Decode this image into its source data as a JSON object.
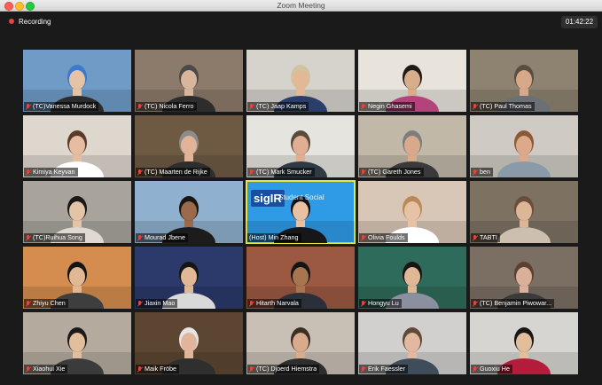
{
  "window": {
    "title": "Zoom Meeting",
    "controls": [
      "close-button",
      "minimize-button",
      "maximize-button"
    ]
  },
  "recording": {
    "label": "Recording",
    "color": "#e0473f"
  },
  "timer": {
    "value": "01:42:22"
  },
  "colors": {
    "active_speaker": "#e5e93a",
    "name_bar_bg": "rgba(0,0,0,0.55)",
    "muted_icon": "#e0473f"
  },
  "participants": [
    {
      "name": "(TC)Vanessa Murdock",
      "muted": true,
      "bg": "#6f9bc6",
      "skin": "#e6c3a5",
      "hair": "#3a7ad0",
      "shirt": "#2c2c2c"
    },
    {
      "name": "(TC) Nicola Ferro",
      "muted": true,
      "bg": "#8c7a6a",
      "skin": "#d8b59b",
      "hair": "#4a4a4a",
      "shirt": "#2d2d2d"
    },
    {
      "name": "(TC) Jaap Kamps",
      "muted": true,
      "bg": "#d6d3cd",
      "skin": "#e2b997",
      "hair": "#d2c3a0",
      "shirt": "#2b3e6a"
    },
    {
      "name": "Negin Ghasemi",
      "muted": true,
      "bg": "#e8e4dc",
      "skin": "#d8ad8a",
      "hair": "#1f1a18",
      "shirt": "#b5437b"
    },
    {
      "name": "(TC) Paul Thomas",
      "muted": true,
      "bg": "#8e8270",
      "skin": "#d7a98a",
      "hair": "#5b4d42",
      "shirt": "#6b6f76"
    },
    {
      "name": "Kimiya Keyvan",
      "muted": true,
      "bg": "#ddd7cd",
      "skin": "#e6bda1",
      "hair": "#5a3a2a",
      "shirt": "#ffffff"
    },
    {
      "name": "(TC) Maarten de Rijke",
      "muted": true,
      "bg": "#6e5a43",
      "skin": "#e1b397",
      "hair": "#8c8c8c",
      "shirt": "#2e2e2e"
    },
    {
      "name": "(TC) Mark Smucker",
      "muted": true,
      "bg": "#e6e4df",
      "skin": "#e0ae92",
      "hair": "#5a4a3c",
      "shirt": "#303a44"
    },
    {
      "name": "(TC) Gareth Jones",
      "muted": true,
      "bg": "#c1b8a8",
      "skin": "#d8a98a",
      "hair": "#7d7d7d",
      "shirt": "#3a3a3a"
    },
    {
      "name": "ben",
      "muted": true,
      "bg": "#cfcbc4",
      "skin": "#dcaa8a",
      "hair": "#8a5a36",
      "shirt": "#8a9aa8"
    },
    {
      "name": "(TC)Ruihua Song",
      "muted": true,
      "bg": "#a8a49c",
      "skin": "#e4c4a6",
      "hair": "#1b1715",
      "shirt": "#e0d8d2"
    },
    {
      "name": "Mourad Jbene",
      "muted": true,
      "bg": "#8fb0cf",
      "skin": "#9a6a4a",
      "hair": "#1a1412",
      "shirt": "#1c1c1c"
    },
    {
      "name": "(Host) Min Zhang",
      "muted": false,
      "active": true,
      "bg": "#2f9be6",
      "skin": "#e7c1a2",
      "hair": "#101010",
      "shirt": "#17171a",
      "banner": "sigIR",
      "banner_sub": "Student Social"
    },
    {
      "name": "Olivia Foulds",
      "muted": true,
      "bg": "#d8c7b6",
      "skin": "#e7c3a6",
      "hair": "#b98a58",
      "shirt": "#ffffff"
    },
    {
      "name": "TABTI",
      "muted": true,
      "bg": "#7d7162",
      "skin": "#ddb597",
      "hair": "#6a4e3a",
      "shirt": "#cdbfb0"
    },
    {
      "name": "Zhiyu Chen",
      "muted": true,
      "bg": "#d58c4f",
      "skin": "#e0b893",
      "hair": "#151515",
      "shirt": "#3e3e3e"
    },
    {
      "name": "Jiaxin Mao",
      "muted": true,
      "bg": "#2b3a6a",
      "skin": "#e0b895",
      "hair": "#151515",
      "shirt": "#d9d9d9"
    },
    {
      "name": "Hitarth Narvala",
      "muted": true,
      "bg": "#9c5942",
      "skin": "#a7764f",
      "hair": "#141414",
      "shirt": "#2a2f3a"
    },
    {
      "name": "Hongyu Lu",
      "muted": true,
      "bg": "#2f6b5a",
      "skin": "#e0b895",
      "hair": "#151515",
      "shirt": "#8c8fa0"
    },
    {
      "name": "(TC) Benjamin Piwowar...",
      "muted": true,
      "bg": "#7b6f63",
      "skin": "#dbb09a",
      "hair": "#5a4030",
      "shirt": "#3a3a3a"
    },
    {
      "name": "Xiaohui Xie",
      "muted": true,
      "bg": "#b4ab9e",
      "skin": "#e3be9d",
      "hair": "#1a1a1a",
      "shirt": "#3b3b3b"
    },
    {
      "name": "Maik Fröbe",
      "muted": true,
      "bg": "#5c4632",
      "skin": "#e2b59a",
      "hair": "#e5e5e5",
      "shirt": "#2f2f2f"
    },
    {
      "name": "(TC) Djoerd Hiemstra",
      "muted": true,
      "bg": "#c9c0b5",
      "skin": "#d8ab8d",
      "hair": "#3b2e25",
      "shirt": "#2e2e2e"
    },
    {
      "name": "Erik Faessler",
      "muted": true,
      "bg": "#d1d0ce",
      "skin": "#e2b8a0",
      "hair": "#5e4a37",
      "shirt": "#3e4d59"
    },
    {
      "name": "Guoxiu He",
      "muted": true,
      "bg": "#d6d5d1",
      "skin": "#e3be9d",
      "hair": "#171717",
      "shirt": "#b31d3b"
    }
  ]
}
